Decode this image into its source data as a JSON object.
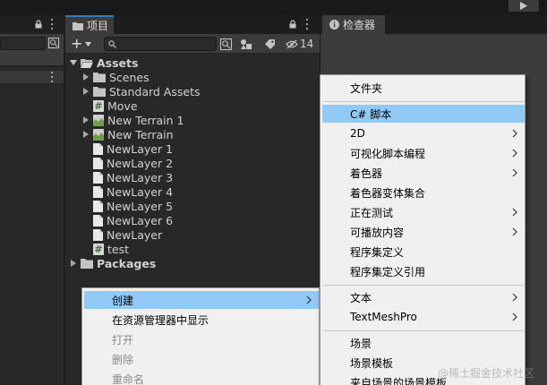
{
  "project_tab": {
    "title": "项目"
  },
  "toolbar": {
    "hidden_count": "14"
  },
  "tree": {
    "root": "Assets",
    "items": [
      {
        "label": "Scenes",
        "type": "folder"
      },
      {
        "label": "Standard Assets",
        "type": "folder"
      },
      {
        "label": "Move",
        "type": "script"
      },
      {
        "label": "New Terrain 1",
        "type": "terrain"
      },
      {
        "label": "New Terrain",
        "type": "terrain"
      },
      {
        "label": "NewLayer 1",
        "type": "file"
      },
      {
        "label": "NewLayer 2",
        "type": "file"
      },
      {
        "label": "NewLayer 3",
        "type": "file"
      },
      {
        "label": "NewLayer 4",
        "type": "file"
      },
      {
        "label": "NewLayer 5",
        "type": "file"
      },
      {
        "label": "NewLayer 6",
        "type": "file"
      },
      {
        "label": "NewLayer",
        "type": "file"
      },
      {
        "label": "test",
        "type": "script"
      }
    ],
    "packages": "Packages"
  },
  "inspector_tab": {
    "title": "检查器"
  },
  "context_menu": {
    "items": [
      {
        "label": "创建",
        "submenu": true,
        "highlighted": true
      },
      {
        "label": "在资源管理器中显示"
      },
      {
        "label": "打开",
        "disabled": true
      },
      {
        "label": "删除",
        "disabled": true
      },
      {
        "label": "重命名",
        "disabled": true
      }
    ]
  },
  "create_menu": {
    "items": [
      {
        "label": "文件夹"
      },
      {
        "label": "C# 脚本",
        "highlighted": true
      },
      {
        "label": "2D",
        "submenu": true
      },
      {
        "label": "可视化脚本编程",
        "submenu": true
      },
      {
        "label": "着色器",
        "submenu": true
      },
      {
        "label": "着色器变体集合"
      },
      {
        "label": "正在测试",
        "submenu": true
      },
      {
        "label": "可播放内容",
        "submenu": true
      },
      {
        "label": "程序集定义"
      },
      {
        "label": "程序集定义引用"
      },
      {
        "label": "文本",
        "submenu": true
      },
      {
        "label": "TextMeshPro",
        "submenu": true
      },
      {
        "label": "场景"
      },
      {
        "label": "场景模板"
      },
      {
        "label": "来自场景的场景模板"
      }
    ]
  },
  "watermark": "@稀土掘金技术社区",
  "icons": {
    "lock": "lock-icon",
    "kebab": "kebab-menu-icon",
    "folder": "folder-icon",
    "search": "search-icon",
    "script": "csharp-script-icon",
    "terrain": "terrain-icon",
    "file": "file-icon",
    "play": "play-icon",
    "info": "info-icon"
  },
  "colors": {
    "menu_highlight": "#91c9f7",
    "tab_accent": "#3a79bb",
    "menu_background": "#f0f0f0"
  }
}
